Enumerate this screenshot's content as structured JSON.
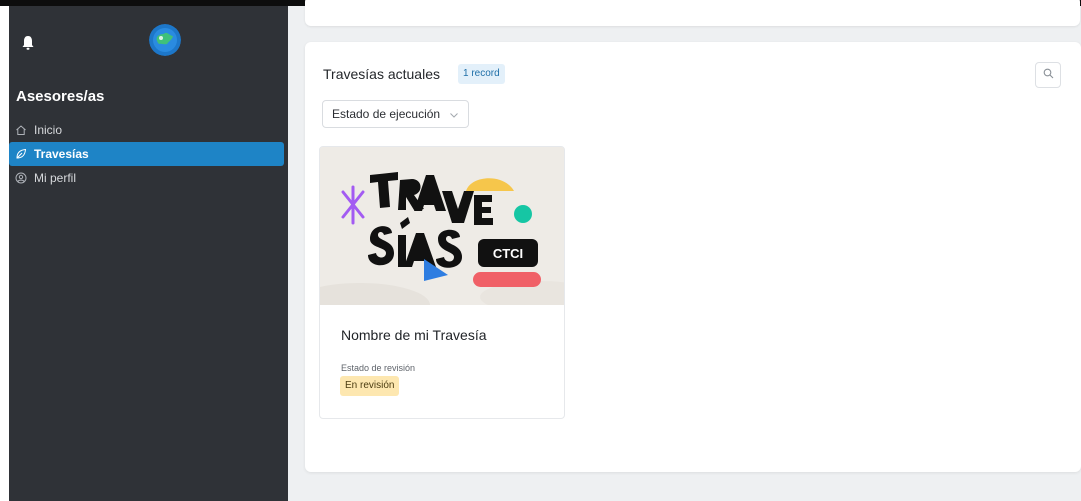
{
  "sidebar": {
    "section_title": "Asesores/as",
    "items": [
      {
        "label": "Inicio",
        "icon": "home-icon",
        "active": false
      },
      {
        "label": "Travesías",
        "icon": "leaf-icon",
        "active": true
      },
      {
        "label": "Mi perfil",
        "icon": "user-circle-icon",
        "active": false
      }
    ]
  },
  "main": {
    "panel_title": "Travesías actuales",
    "record_count": "1 record",
    "filter": {
      "label": "Estado de ejecución"
    },
    "cards": [
      {
        "title": "Nombre de mi Travesía",
        "meta_label": "Estado de revisión",
        "status": "En revisión",
        "image_alt_text": "TRAVESÍAS CTCI"
      }
    ]
  },
  "colors": {
    "sidebar_bg": "#2f3237",
    "active_item": "#1e84c6",
    "main_bg": "#eef0f2",
    "badge_blue_bg": "#e3f0fa",
    "status_yellow_bg": "#fde7b0"
  }
}
